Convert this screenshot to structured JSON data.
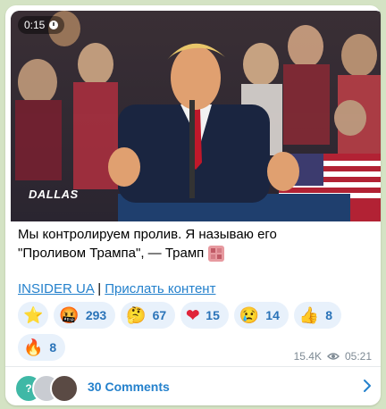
{
  "video": {
    "duration": "0:15",
    "watermark": "DALLAS"
  },
  "post": {
    "line1": "Мы контролируем пролив. Я называю его",
    "line2": "\"Проливом Трампа\", — Трамп",
    "link1": "INSIDER UA",
    "separator": " | ",
    "link2": "Прислать контент"
  },
  "reactions": [
    {
      "icon": "star-icon",
      "emoji": "⭐",
      "count": ""
    },
    {
      "icon": "angry-face-icon",
      "emoji": "🤬",
      "count": "293"
    },
    {
      "icon": "thinking-face-icon",
      "emoji": "🤔",
      "count": "67"
    },
    {
      "icon": "heart-icon",
      "emoji": "❤",
      "count": "15"
    },
    {
      "icon": "crying-face-icon",
      "emoji": "😢",
      "count": "14"
    },
    {
      "icon": "thumbs-up-icon",
      "emoji": "👍",
      "count": "8"
    },
    {
      "icon": "fire-icon",
      "emoji": "🔥",
      "count": "8"
    }
  ],
  "meta": {
    "views": "15.4K",
    "time": "05:21"
  },
  "comments": {
    "label": "30 Comments",
    "first_avatar": "?"
  },
  "colors": {
    "accent": "#2481cc",
    "chip_bg": "#e8f1fb",
    "background": "#d4e3c4"
  }
}
